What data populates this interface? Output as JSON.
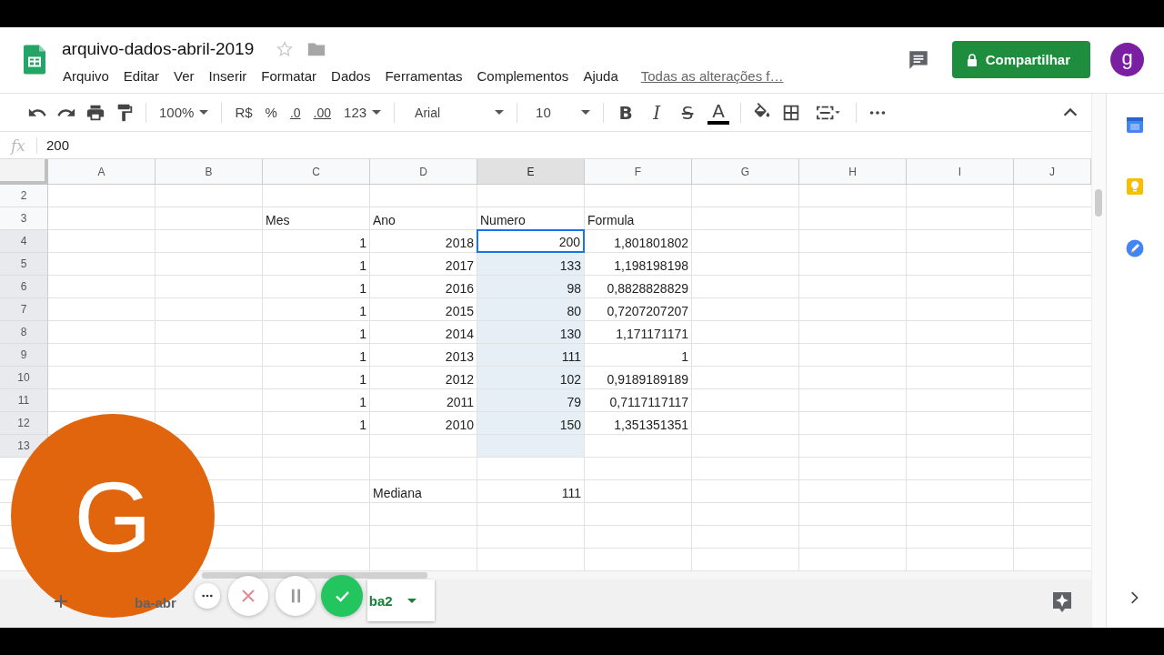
{
  "document": {
    "title": "arquivo-dados-abril-2019",
    "starred": false
  },
  "menu": [
    "Arquivo",
    "Editar",
    "Ver",
    "Inserir",
    "Formatar",
    "Dados",
    "Ferramentas",
    "Complementos",
    "Ajuda"
  ],
  "save_status": "Todas as alterações f…",
  "share_button": "Compartilhar",
  "account": {
    "initial": "g"
  },
  "toolbar": {
    "zoom": "100%",
    "currency": "R$",
    "percent": "%",
    "decrease_decimals": ".0",
    "increase_decimals": ".00",
    "number_format": "123",
    "font": "Arial",
    "font_size": "10",
    "bold": "B",
    "italic": "I",
    "strikethrough": "S",
    "text_color": "A"
  },
  "formula_bar": {
    "label": "fx",
    "value": "200"
  },
  "columns": [
    {
      "label": "A",
      "selected": false
    },
    {
      "label": "B",
      "selected": false
    },
    {
      "label": "C",
      "selected": false
    },
    {
      "label": "D",
      "selected": false
    },
    {
      "label": "E",
      "selected": true
    },
    {
      "label": "F",
      "selected": false
    },
    {
      "label": "G",
      "selected": false
    },
    {
      "label": "H",
      "selected": false
    },
    {
      "label": "I",
      "selected": false
    },
    {
      "label": "J",
      "selected": false
    }
  ],
  "rows": [
    {
      "label": "2",
      "selected": false,
      "active": false,
      "cells": {}
    },
    {
      "label": "3",
      "selected": false,
      "active": false,
      "cells": {
        "C": "Mes",
        "D": "Ano",
        "E": "Numero",
        "F": "Formula"
      }
    },
    {
      "label": "4",
      "selected": true,
      "active": true,
      "cells": {
        "C": "1",
        "D": "2018",
        "E": "200",
        "F": "1,801801802"
      }
    },
    {
      "label": "5",
      "selected": true,
      "active": false,
      "cells": {
        "C": "1",
        "D": "2017",
        "E": "133",
        "F": "1,198198198"
      }
    },
    {
      "label": "6",
      "selected": true,
      "active": false,
      "cells": {
        "C": "1",
        "D": "2016",
        "E": "98",
        "F": "0,8828828829"
      }
    },
    {
      "label": "7",
      "selected": true,
      "active": false,
      "cells": {
        "C": "1",
        "D": "2015",
        "E": "80",
        "F": "0,7207207207"
      }
    },
    {
      "label": "8",
      "selected": true,
      "active": false,
      "cells": {
        "C": "1",
        "D": "2014",
        "E": "130",
        "F": "1,171171171"
      }
    },
    {
      "label": "9",
      "selected": true,
      "active": false,
      "cells": {
        "C": "1",
        "D": "2013",
        "E": "111",
        "F": "1"
      }
    },
    {
      "label": "10",
      "selected": true,
      "active": false,
      "cells": {
        "C": "1",
        "D": "2012",
        "E": "102",
        "F": "0,9189189189"
      }
    },
    {
      "label": "11",
      "selected": true,
      "active": false,
      "cells": {
        "C": "1",
        "D": "2011",
        "E": "79",
        "F": "0,7117117117"
      }
    },
    {
      "label": "12",
      "selected": true,
      "active": false,
      "cells": {
        "C": "1",
        "D": "2010",
        "E": "150",
        "F": "1,351351351"
      }
    },
    {
      "label": "13",
      "selected": true,
      "active": false,
      "cells": {}
    },
    {
      "active": false,
      "cells": {}
    },
    {
      "active": false,
      "cells": {
        "D": "Mediana",
        "E": "111"
      }
    },
    {
      "active": false,
      "cells": {}
    },
    {
      "active": false,
      "cells": {}
    },
    {
      "active": false,
      "cells": {}
    }
  ],
  "sheet_tabs": [
    {
      "label": "ba-abr",
      "selected": false
    },
    {
      "label": "ba2",
      "selected": true
    }
  ],
  "recorder": {
    "avatar_initial": "G"
  }
}
